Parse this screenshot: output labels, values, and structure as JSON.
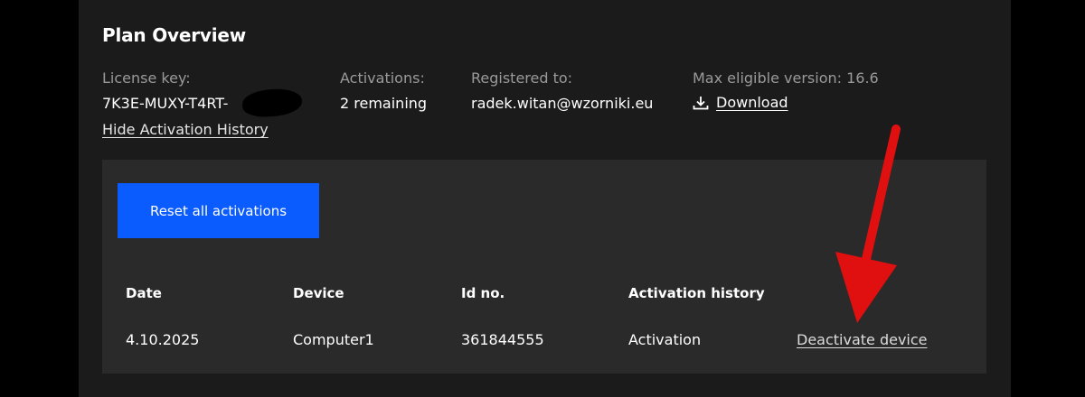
{
  "plan": {
    "title": "Plan Overview",
    "license_label": "License key:",
    "license_value": "7K3E-MUXY-T4RT-",
    "hide_history_link": "Hide Activation History",
    "activations_label": "Activations:",
    "activations_value": "2 remaining",
    "registered_label": "Registered to:",
    "registered_value": "radek.witan@wzorniki.eu",
    "version_label": "Max eligible version: 16.6",
    "download_label": "Download"
  },
  "history": {
    "reset_button": "Reset all activations",
    "headers": [
      "Date",
      "Device",
      "Id no.",
      "Activation history"
    ],
    "rows": [
      {
        "date": "4.10.2025",
        "device": "Computer1",
        "id": "361844555",
        "event": "Activation",
        "action": "Deactivate device"
      }
    ]
  },
  "icons": {
    "download": "download-icon",
    "annotation": "red-arrow-annotation"
  },
  "colors": {
    "accent": "#0a5cff",
    "annotation": "#e01010",
    "card_bg": "#1b1b1b",
    "panel_bg": "#2a2a2a"
  }
}
